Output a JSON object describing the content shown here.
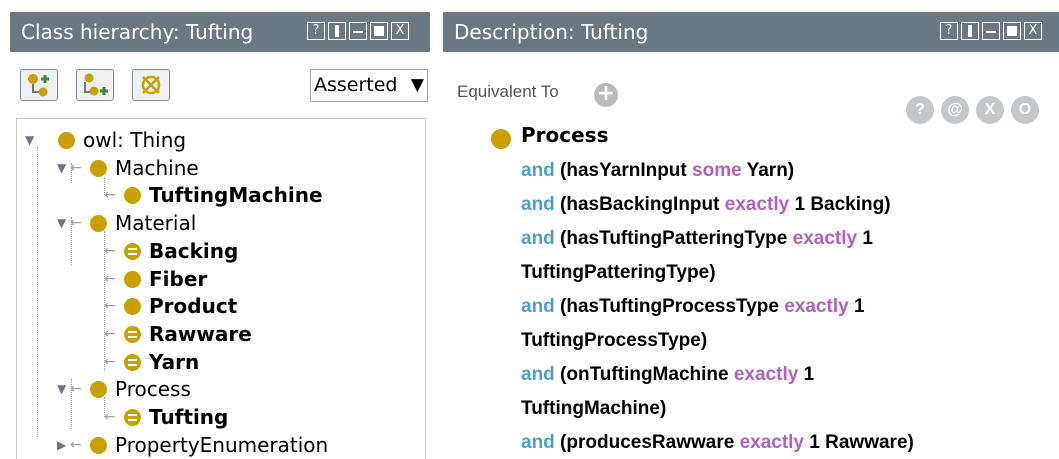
{
  "left_panel": {
    "title": "Class hierarchy: Tufting",
    "window_buttons": [
      "?",
      "restore",
      "minimize",
      "maximize",
      "X"
    ],
    "toolbar": {
      "add_subclass_icon": "add-subclass-icon",
      "add_sibling_icon": "add-sibling-icon",
      "delete_icon": "delete-class-icon",
      "view_mode": "Asserted"
    },
    "tree": [
      {
        "label": "owl: Thing",
        "bold": false,
        "depth": 0,
        "expanded": true,
        "equivalent": false
      },
      {
        "label": "Machine",
        "bold": false,
        "depth": 1,
        "expanded": true,
        "equivalent": false
      },
      {
        "label": "TuftingMachine",
        "bold": true,
        "depth": 2,
        "expanded": null,
        "equivalent": false
      },
      {
        "label": "Material",
        "bold": false,
        "depth": 1,
        "expanded": true,
        "equivalent": false
      },
      {
        "label": "Backing",
        "bold": true,
        "depth": 2,
        "expanded": null,
        "equivalent": true
      },
      {
        "label": "Fiber",
        "bold": true,
        "depth": 2,
        "expanded": null,
        "equivalent": false
      },
      {
        "label": "Product",
        "bold": true,
        "depth": 2,
        "expanded": null,
        "equivalent": false
      },
      {
        "label": "Rawware",
        "bold": true,
        "depth": 2,
        "expanded": null,
        "equivalent": true
      },
      {
        "label": "Yarn",
        "bold": true,
        "depth": 2,
        "expanded": null,
        "equivalent": true
      },
      {
        "label": "Process",
        "bold": false,
        "depth": 1,
        "expanded": true,
        "equivalent": false
      },
      {
        "label": "Tufting",
        "bold": true,
        "depth": 2,
        "expanded": null,
        "equivalent": true,
        "selected": true
      },
      {
        "label": "PropertyEnumeration",
        "bold": false,
        "depth": 1,
        "expanded": false,
        "equivalent": false
      }
    ]
  },
  "right_panel": {
    "title": "Description: Tufting",
    "window_buttons": [
      "?",
      "restore",
      "minimize",
      "maximize",
      "X"
    ],
    "section_label": "Equivalent To",
    "add_button": "+",
    "action_buttons": [
      "?",
      "@",
      "X",
      "O"
    ],
    "class_name": "Process",
    "axiom_lines": [
      [
        {
          "t": "and",
          "k": "and"
        },
        {
          "t": " (hasYarnInput ",
          "k": "b"
        },
        {
          "t": "some",
          "k": "p"
        },
        {
          "t": " Yarn)",
          "k": "b"
        }
      ],
      [
        {
          "t": "and",
          "k": "and"
        },
        {
          "t": " (hasBackingInput ",
          "k": "b"
        },
        {
          "t": "exactly",
          "k": "p"
        },
        {
          "t": " 1 Backing)",
          "k": "b"
        }
      ],
      [
        {
          "t": "and",
          "k": "and"
        },
        {
          "t": " (hasTuftingPatteringType ",
          "k": "b"
        },
        {
          "t": "exactly",
          "k": "p"
        },
        {
          "t": " 1",
          "k": "b"
        }
      ],
      [
        {
          "t": "TuftingPatteringType)",
          "k": "b"
        }
      ],
      [
        {
          "t": "and",
          "k": "and"
        },
        {
          "t": " (hasTuftingProcessType ",
          "k": "b"
        },
        {
          "t": "exactly",
          "k": "p"
        },
        {
          "t": " 1",
          "k": "b"
        }
      ],
      [
        {
          "t": "TuftingProcessType)",
          "k": "b"
        }
      ],
      [
        {
          "t": "and",
          "k": "and"
        },
        {
          "t": " (onTuftingMachine ",
          "k": "b"
        },
        {
          "t": "exactly",
          "k": "p"
        },
        {
          "t": " 1",
          "k": "b"
        }
      ],
      [
        {
          "t": "TuftingMachine)",
          "k": "b"
        }
      ],
      [
        {
          "t": "and",
          "k": "and"
        },
        {
          "t": " (producesRawware ",
          "k": "b"
        },
        {
          "t": "exactly",
          "k": "p"
        },
        {
          "t": " 1 Rawware)",
          "k": "b"
        }
      ]
    ]
  },
  "colors": {
    "titlebar": "#6b7884",
    "class_dot": "#c8a000",
    "keyword_and": "#4a9fd0",
    "keyword_quantifier": "#b060c0"
  }
}
